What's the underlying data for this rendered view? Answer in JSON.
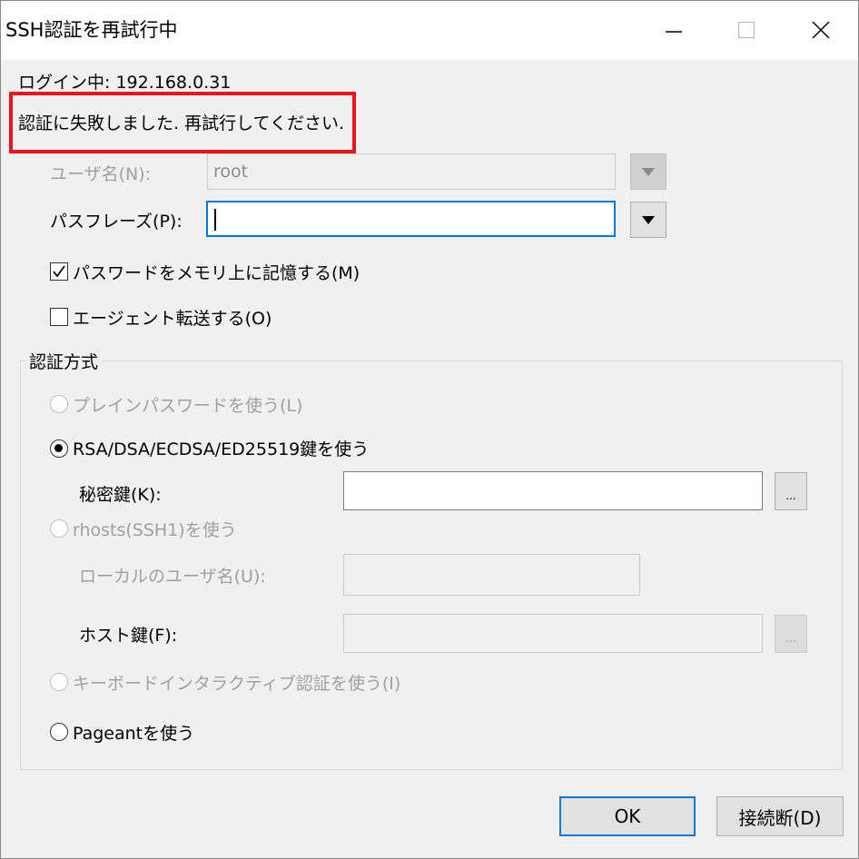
{
  "window": {
    "title": "SSH認証を再試行中",
    "minimize_icon": "minimize-icon",
    "maximize_icon": "maximize-icon",
    "close_icon": "close-icon"
  },
  "status": {
    "login_label": "ログイン中:",
    "login_host": "192.168.0.31",
    "error_message": "認証に失敗しました. 再試行してください."
  },
  "username": {
    "label": "ユーザ名(N):",
    "value": "root"
  },
  "passphrase": {
    "label": "パスフレーズ(P):",
    "value": ""
  },
  "remember_password": {
    "label": "パスワードをメモリ上に記憶する(M)",
    "checked": true
  },
  "agent_forward": {
    "label": "エージェント転送する(O)",
    "checked": false
  },
  "auth_method": {
    "group_label": "認証方式",
    "plain_password": "プレインパスワードを使う(L)",
    "rsa_key": "RSA/DSA/ECDSA/ED25519鍵を使う",
    "private_key_label": "秘密鍵(K):",
    "private_key_value": "",
    "rhosts": "rhosts(SSH1)を使う",
    "local_user_label": "ローカルのユーザ名(U):",
    "local_user_value": "",
    "host_key_label": "ホスト鍵(F):",
    "host_key_value": "",
    "keyboard_interactive": "キーボードインタラクティブ認証を使う(I)",
    "pageant": "Pageantを使う",
    "selected": "rsa_key"
  },
  "buttons": {
    "browse": "...",
    "ok": "OK",
    "disconnect": "接続断(D)"
  },
  "colors": {
    "highlight_border": "#e8141b",
    "focus_accent": "#0078d7"
  }
}
